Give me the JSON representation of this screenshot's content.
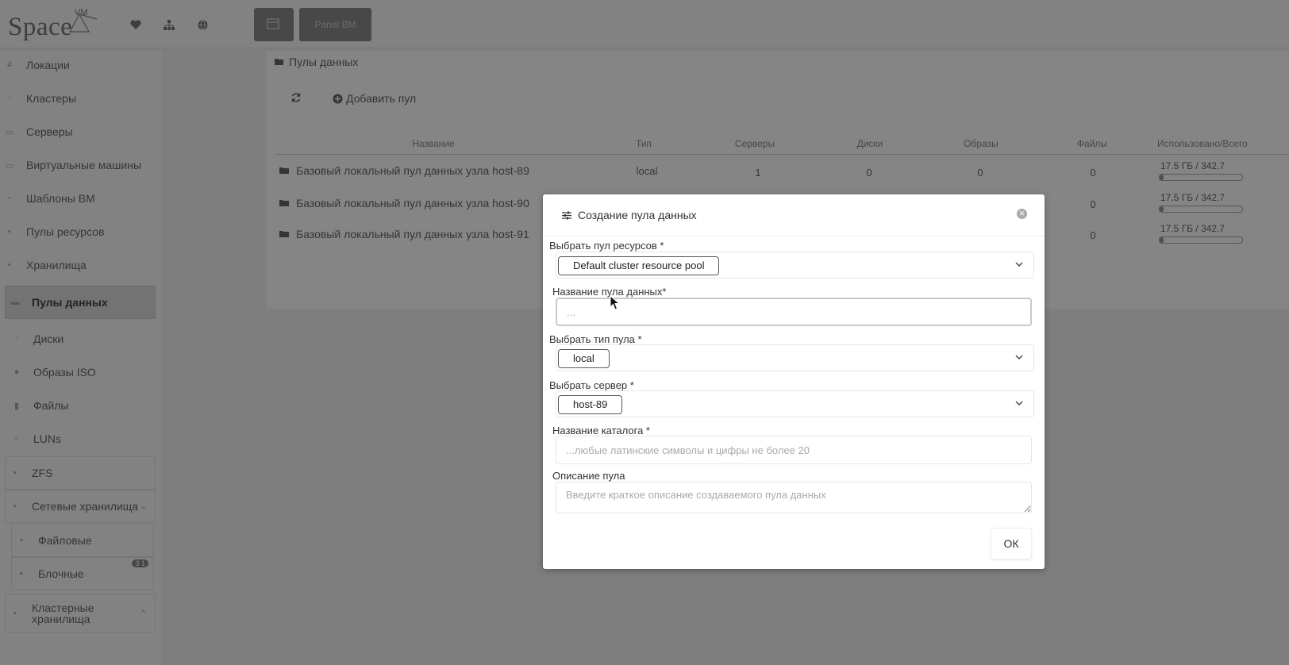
{
  "app": {
    "logo_text": "Space",
    "logo_vm": "VM",
    "top_icons": [
      "heart-icon",
      "sitemap-icon",
      "globe-icon"
    ],
    "top_button_label": "Panel BM"
  },
  "sidebar": {
    "items": [
      {
        "label": "Локации",
        "icon": "hash-icon"
      },
      {
        "label": "Кластеры",
        "icon": "cluster-icon"
      },
      {
        "label": "Серверы",
        "icon": "server-icon"
      },
      {
        "label": "Виртуальные машины",
        "icon": "vm-icon"
      },
      {
        "label": "Шаблоны ВМ",
        "icon": "template-icon"
      },
      {
        "label": "Пулы ресурсов",
        "icon": "resource-pool-icon"
      },
      {
        "label": "Хранилища",
        "icon": "storage-icon"
      },
      {
        "label": "Пулы данных",
        "icon": "folder-icon",
        "active": true
      },
      {
        "label": "Диски",
        "icon": "disk-icon"
      },
      {
        "label": "Образы ISO",
        "icon": "iso-icon"
      },
      {
        "label": "Файлы",
        "icon": "file-icon"
      },
      {
        "label": "LUNs",
        "icon": "lun-icon"
      },
      {
        "label": "ZFS",
        "icon": "zfs-icon"
      },
      {
        "label": "Сетевые хранилища",
        "icon": "network-storage-icon"
      },
      {
        "label": "Файловые",
        "icon": "file-storage-icon"
      },
      {
        "label": "Блочные",
        "icon": "block-storage-icon",
        "badge": "3 1"
      },
      {
        "label": "Кластерные хранилища",
        "icon": "cluster-storage-icon"
      }
    ]
  },
  "main": {
    "breadcrumb": "Пулы данных",
    "add_pool_label": "Добавить пул",
    "columns": [
      "Название",
      "Тип",
      "Серверы",
      "Диски",
      "Образы",
      "Файлы",
      "Использовано/Всего"
    ],
    "rows": [
      {
        "name": "Базовый локальный пул данных узла host-89",
        "type": "local",
        "servers": "1",
        "disks": "0",
        "images": "0",
        "files": "0",
        "usage": "17.5 ГБ / 342.7",
        "usage_fraction": 0.05
      },
      {
        "name": "Базовый локальный пул данных узла host-90",
        "type": "",
        "servers": "",
        "disks": "",
        "images": "",
        "files": "0",
        "usage": "17.5 ГБ / 342.7",
        "usage_fraction": 0.05
      },
      {
        "name": "Базовый локальный пул данных узла host-91",
        "type": "",
        "servers": "",
        "disks": "",
        "images": "",
        "files": "0",
        "usage": "17.5 ГБ / 342.7",
        "usage_fraction": 0.05
      }
    ]
  },
  "modal": {
    "title": "Создание пула данных",
    "resource_pool_label": "Выбрать пул ресурсов *",
    "resource_pool_value": "Default cluster resource pool",
    "pool_name_label": "Название пула данных*",
    "pool_name_placeholder": "...",
    "pool_type_label": "Выбрать тип пула *",
    "pool_type_value": "local",
    "server_label": "Выбрать сервер *",
    "server_value": "host-89",
    "catalog_label": "Название каталога *",
    "catalog_placeholder": "...любые латинские символы и цифры не более 20",
    "description_label": "Описание пула",
    "description_placeholder": "Введите краткое описание создаваемого пула данных",
    "ok_label": "ОК"
  }
}
